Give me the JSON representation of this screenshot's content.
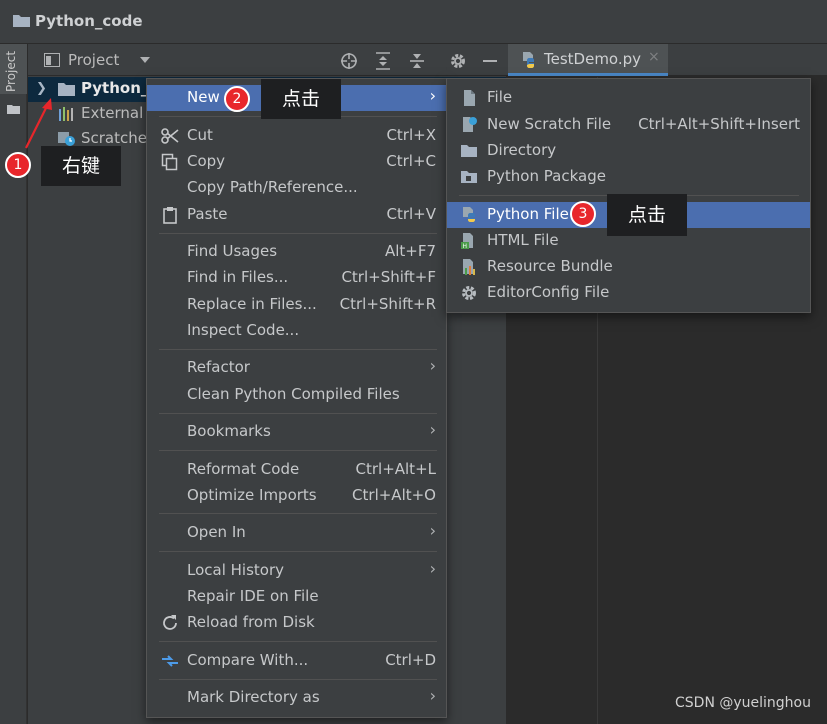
{
  "window": {
    "title": "Python_code"
  },
  "tool_strip": {
    "project_tab": "Project"
  },
  "project_panel": {
    "title": "Project"
  },
  "editor": {
    "tabs": [
      {
        "label": "TestDemo.py",
        "close": "×"
      }
    ]
  },
  "tree": {
    "items": [
      {
        "label": "Python_c"
      },
      {
        "label": "External L"
      },
      {
        "label": "Scratche"
      }
    ]
  },
  "context_menu": {
    "items": [
      {
        "label": "New",
        "shortcut": "",
        "submenu": "›"
      },
      {
        "label": "Cut",
        "shortcut": "Ctrl+X"
      },
      {
        "label": "Copy",
        "shortcut": "Ctrl+C"
      },
      {
        "label": "Copy Path/Reference...",
        "shortcut": ""
      },
      {
        "label": "Paste",
        "shortcut": "Ctrl+V"
      },
      {
        "label": "Find Usages",
        "shortcut": "Alt+F7"
      },
      {
        "label": "Find in Files...",
        "shortcut": "Ctrl+Shift+F"
      },
      {
        "label": "Replace in Files...",
        "shortcut": "Ctrl+Shift+R"
      },
      {
        "label": "Inspect Code...",
        "shortcut": ""
      },
      {
        "label": "Refactor",
        "shortcut": "",
        "submenu": "›"
      },
      {
        "label": "Clean Python Compiled Files",
        "shortcut": ""
      },
      {
        "label": "Bookmarks",
        "shortcut": "",
        "submenu": "›"
      },
      {
        "label": "Reformat Code",
        "shortcut": "Ctrl+Alt+L"
      },
      {
        "label": "Optimize Imports",
        "shortcut": "Ctrl+Alt+O"
      },
      {
        "label": "Open In",
        "shortcut": "",
        "submenu": "›"
      },
      {
        "label": "Local History",
        "shortcut": "",
        "submenu": "›"
      },
      {
        "label": "Repair IDE on File",
        "shortcut": ""
      },
      {
        "label": "Reload from Disk",
        "shortcut": ""
      },
      {
        "label": "Compare With...",
        "shortcut": "Ctrl+D"
      },
      {
        "label": "Mark Directory as",
        "shortcut": "",
        "submenu": "›"
      }
    ]
  },
  "new_submenu": {
    "items": [
      {
        "label": "File",
        "shortcut": ""
      },
      {
        "label": "New Scratch File",
        "shortcut": "Ctrl+Alt+Shift+Insert"
      },
      {
        "label": "Directory",
        "shortcut": ""
      },
      {
        "label": "Python Package",
        "shortcut": ""
      },
      {
        "label": "Python File",
        "shortcut": ""
      },
      {
        "label": "HTML File",
        "shortcut": ""
      },
      {
        "label": "Resource Bundle",
        "shortcut": ""
      },
      {
        "label": "EditorConfig File",
        "shortcut": ""
      }
    ]
  },
  "annotations": {
    "step1": {
      "number": "1",
      "text": "右键"
    },
    "step2": {
      "number": "2",
      "text": "点击"
    },
    "step3": {
      "number": "3",
      "text": "点击"
    }
  },
  "watermark": "CSDN @yuelinghou",
  "colors": {
    "selection": "#4b6eaf",
    "badge": "#e8262b",
    "tree_selected": "#0d293e"
  }
}
